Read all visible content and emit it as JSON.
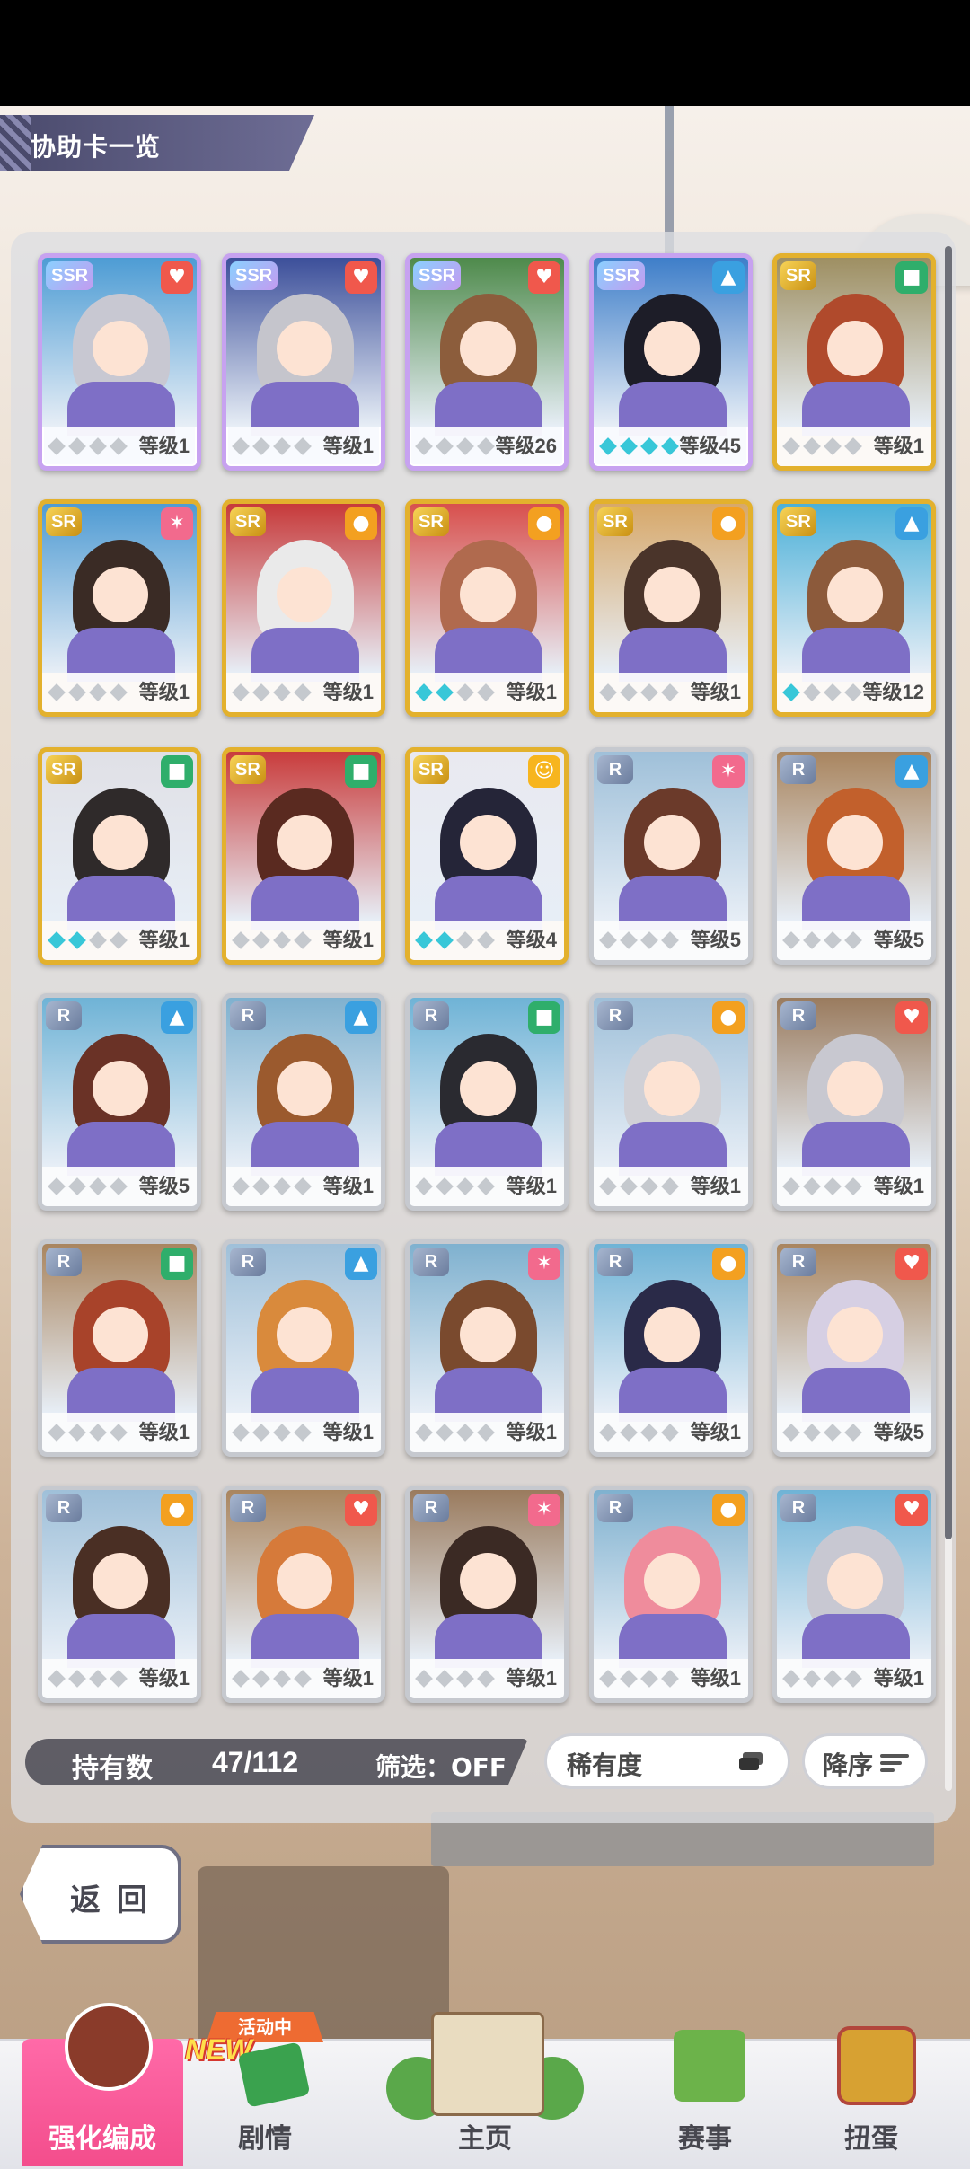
{
  "header": {
    "title": "协助卡一览"
  },
  "cards": [
    {
      "rarity": "SSR",
      "type": "heart",
      "level": "等级1",
      "gems": [
        0,
        0,
        0,
        0
      ],
      "hair": "#c8c8d2",
      "top": "#4d9cd4"
    },
    {
      "rarity": "SSR",
      "type": "heart",
      "level": "等级1",
      "gems": [
        0,
        0,
        0,
        0
      ],
      "hair": "#c5c5cc",
      "top": "#3c4f9a"
    },
    {
      "rarity": "SSR",
      "type": "heart",
      "level": "等级26",
      "gems": [
        0,
        0,
        0,
        0
      ],
      "hair": "#8c5d3c",
      "top": "#4e8a4b"
    },
    {
      "rarity": "SSR",
      "type": "shoe",
      "level": "等级45",
      "gems": [
        1,
        1,
        1,
        1
      ],
      "hair": "#1d1d28",
      "top": "#3e7ec9"
    },
    {
      "rarity": "SR",
      "type": "hat",
      "level": "等级1",
      "gems": [
        0,
        0,
        0,
        0
      ],
      "hair": "#b04a2c",
      "top": "#9e8f62"
    },
    {
      "rarity": "SR",
      "type": "fire",
      "level": "等级1",
      "gems": [
        0,
        0,
        0,
        0
      ],
      "hair": "#3a2b25",
      "top": "#4f9bd3"
    },
    {
      "rarity": "SR",
      "type": "muscle",
      "level": "等级1",
      "gems": [
        0,
        0,
        0,
        0
      ],
      "hair": "#eaeaea",
      "top": "#c73a3a"
    },
    {
      "rarity": "SR",
      "type": "muscle",
      "level": "等级1",
      "gems": [
        1,
        1,
        0,
        0
      ],
      "hair": "#b06a4e",
      "top": "#d8504d"
    },
    {
      "rarity": "SR",
      "type": "muscle",
      "level": "等级1",
      "gems": [
        0,
        0,
        0,
        0
      ],
      "hair": "#4a342a",
      "top": "#d7a86a"
    },
    {
      "rarity": "SR",
      "type": "shoe",
      "level": "等级12",
      "gems": [
        1,
        0,
        0,
        0
      ],
      "hair": "#8c5a3b",
      "top": "#4bb0d8"
    },
    {
      "rarity": "SR",
      "type": "hat",
      "level": "等级1",
      "gems": [
        1,
        1,
        0,
        0
      ],
      "hair": "#2f2a2a",
      "top": "#e0e0e6"
    },
    {
      "rarity": "SR",
      "type": "hat",
      "level": "等级1",
      "gems": [
        0,
        0,
        0,
        0
      ],
      "hair": "#5a2a20",
      "top": "#c93c3c"
    },
    {
      "rarity": "SR",
      "type": "pal",
      "level": "等级4",
      "gems": [
        1,
        1,
        0,
        0
      ],
      "hair": "#252538",
      "top": "#e9e9f0"
    },
    {
      "rarity": "R",
      "type": "fire",
      "level": "等级5",
      "gems": [
        0,
        0,
        0,
        0
      ],
      "hair": "#6b3a2a",
      "top": "#9fc0d9"
    },
    {
      "rarity": "R",
      "type": "shoe",
      "level": "等级5",
      "gems": [
        0,
        0,
        0,
        0
      ],
      "hair": "#c2602c",
      "top": "#a9855f"
    },
    {
      "rarity": "R",
      "type": "shoe",
      "level": "等级5",
      "gems": [
        0,
        0,
        0,
        0
      ],
      "hair": "#6a3226",
      "top": "#6fb3d6"
    },
    {
      "rarity": "R",
      "type": "shoe",
      "level": "等级1",
      "gems": [
        0,
        0,
        0,
        0
      ],
      "hair": "#9b5a2e",
      "top": "#7fb1cf"
    },
    {
      "rarity": "R",
      "type": "hat",
      "level": "等级1",
      "gems": [
        0,
        0,
        0,
        0
      ],
      "hair": "#2a2a30",
      "top": "#6fb3d6"
    },
    {
      "rarity": "R",
      "type": "muscle",
      "level": "等级1",
      "gems": [
        0,
        0,
        0,
        0
      ],
      "hair": "#d0d0d6",
      "top": "#9fc0d9"
    },
    {
      "rarity": "R",
      "type": "heart",
      "level": "等级1",
      "gems": [
        0,
        0,
        0,
        0
      ],
      "hair": "#c8c8d0",
      "top": "#9a7b5e"
    },
    {
      "rarity": "R",
      "type": "hat",
      "level": "等级1",
      "gems": [
        0,
        0,
        0,
        0
      ],
      "hair": "#a8432a",
      "top": "#a9855f"
    },
    {
      "rarity": "R",
      "type": "shoe",
      "level": "等级1",
      "gems": [
        0,
        0,
        0,
        0
      ],
      "hair": "#d98a3c",
      "top": "#9fc0d9"
    },
    {
      "rarity": "R",
      "type": "fire",
      "level": "等级1",
      "gems": [
        0,
        0,
        0,
        0
      ],
      "hair": "#7a4a2e",
      "top": "#7fb1cf"
    },
    {
      "rarity": "R",
      "type": "muscle",
      "level": "等级1",
      "gems": [
        0,
        0,
        0,
        0
      ],
      "hair": "#2a2a48",
      "top": "#6fb3d6"
    },
    {
      "rarity": "R",
      "type": "heart",
      "level": "等级5",
      "gems": [
        0,
        0,
        0,
        0
      ],
      "hair": "#d6cfe3",
      "top": "#a9855f"
    },
    {
      "rarity": "R",
      "type": "muscle",
      "level": "等级1",
      "gems": [
        0,
        0,
        0,
        0
      ],
      "hair": "#4a2f24",
      "top": "#9fc0d9"
    },
    {
      "rarity": "R",
      "type": "heart",
      "level": "等级1",
      "gems": [
        0,
        0,
        0,
        0
      ],
      "hair": "#d67a3a",
      "top": "#a9855f"
    },
    {
      "rarity": "R",
      "type": "fire",
      "level": "等级1",
      "gems": [
        0,
        0,
        0,
        0
      ],
      "hair": "#3b2a24",
      "top": "#9a7b5e"
    },
    {
      "rarity": "R",
      "type": "muscle",
      "level": "等级1",
      "gems": [
        0,
        0,
        0,
        0
      ],
      "hair": "#ef8c9c",
      "top": "#7fb1cf"
    },
    {
      "rarity": "R",
      "type": "heart",
      "level": "等级1",
      "gems": [
        0,
        0,
        0,
        0
      ],
      "hair": "#c8c8d2",
      "top": "#6fb3d6"
    }
  ],
  "type_colors": {
    "heart": "#f0584c",
    "shoe": "#3aa0e0",
    "hat": "#2fae6b",
    "fire": "#f26a8d",
    "muscle": "#f3a020",
    "pal": "#f7b51e"
  },
  "type_icons": {
    "heart": "heart-icon",
    "shoe": "shoe-icon",
    "hat": "hat-icon",
    "fire": "fire-icon",
    "muscle": "muscle-icon",
    "pal": "friend-icon"
  },
  "footer": {
    "count_label": "持有数",
    "count_value": "47/112",
    "filter_label": "筛选：OFF",
    "sort_label": "稀有度",
    "order_label": "降序"
  },
  "back_label": "返回",
  "nav": {
    "event_tag": "活动中",
    "new_badge": "NEW",
    "items": [
      {
        "label": "强化编成"
      },
      {
        "label": "剧情"
      },
      {
        "label": "主页"
      },
      {
        "label": "赛事"
      },
      {
        "label": "扭蛋"
      }
    ]
  }
}
